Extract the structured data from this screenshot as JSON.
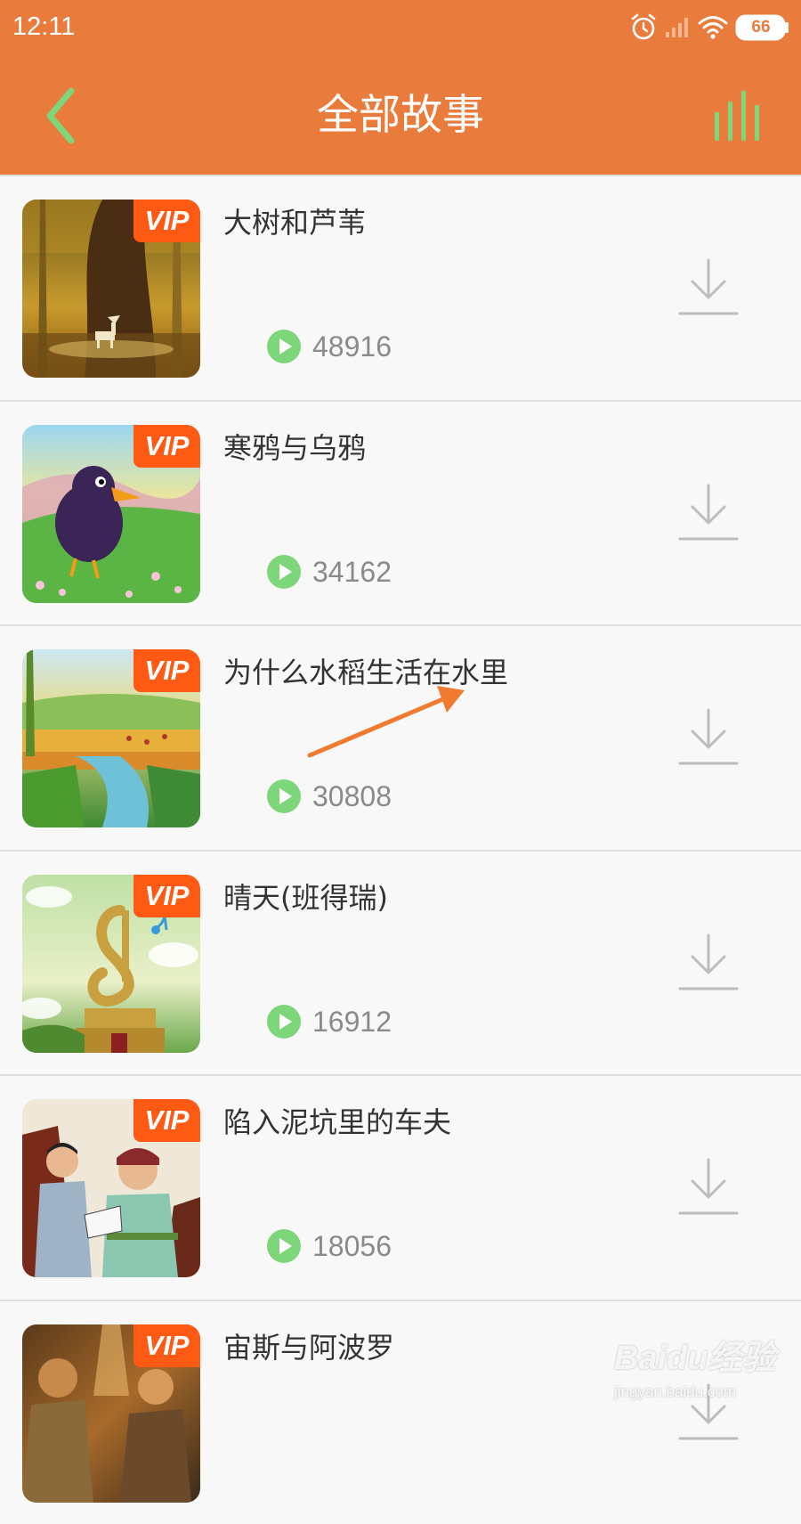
{
  "status_bar": {
    "time": "12:11",
    "battery": "66",
    "icons": [
      "alarm-icon",
      "signal-icon",
      "wifi-icon",
      "battery-icon"
    ]
  },
  "header": {
    "title": "全部故事",
    "back_icon": "chevron-left-icon",
    "now_playing_icon": "equalizer-icon",
    "icon_color": "#7ed67a",
    "background": "#e97c3c"
  },
  "stories": [
    {
      "title": "大树和芦苇",
      "plays": "48916",
      "badge": "VIP"
    },
    {
      "title": "寒鸦与乌鸦",
      "plays": "34162",
      "badge": "VIP"
    },
    {
      "title": "为什么水稻生活在水里",
      "plays": "30808",
      "badge": "VIP"
    },
    {
      "title": "晴天(班得瑞)",
      "plays": "16912",
      "badge": "VIP"
    },
    {
      "title": "陷入泥坑里的车夫",
      "plays": "18056",
      "badge": "VIP"
    },
    {
      "title": "宙斯与阿波罗",
      "plays": "",
      "badge": "VIP"
    }
  ],
  "colors": {
    "vip_badge": "#ff5a14",
    "play_icon": "#7ed67a",
    "annotation_arrow": "#f07a30"
  },
  "watermark": {
    "logo": "Baidu经验",
    "url": "jingyan.baidu.com"
  }
}
